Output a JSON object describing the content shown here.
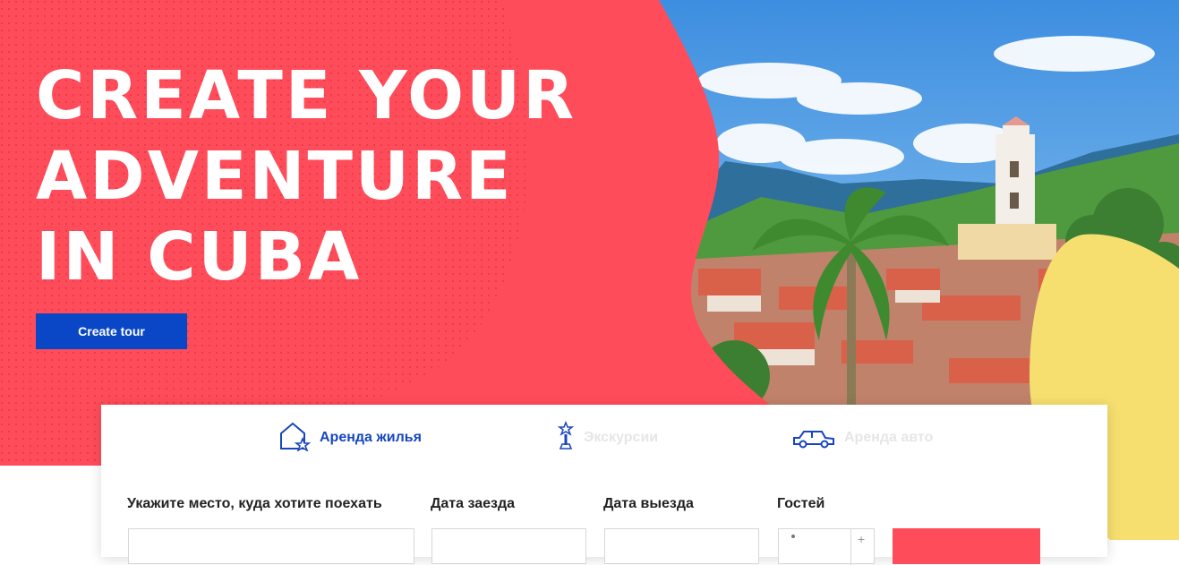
{
  "hero": {
    "title_lines": [
      "CREATE YOUR",
      "ADVENTURE",
      "IN CUBA"
    ],
    "create_tour_label": "Create tour"
  },
  "tabs": [
    {
      "label": "Аренда жилья",
      "icon": "house-star-icon",
      "active": true
    },
    {
      "label": "Экскурсии",
      "icon": "monument-icon",
      "active": false
    },
    {
      "label": "Аренда авто",
      "icon": "car-icon",
      "active": false
    }
  ],
  "fields": {
    "place_label": "Укажите место, куда хотите поехать",
    "checkin_label": "Дата заезда",
    "checkout_label": "Дата выезда",
    "guests_label": "Гостей"
  },
  "colors": {
    "hero_red": "#ff4c5a",
    "primary_blue": "#0a47c7",
    "accent_yellow": "#f6df6f"
  }
}
